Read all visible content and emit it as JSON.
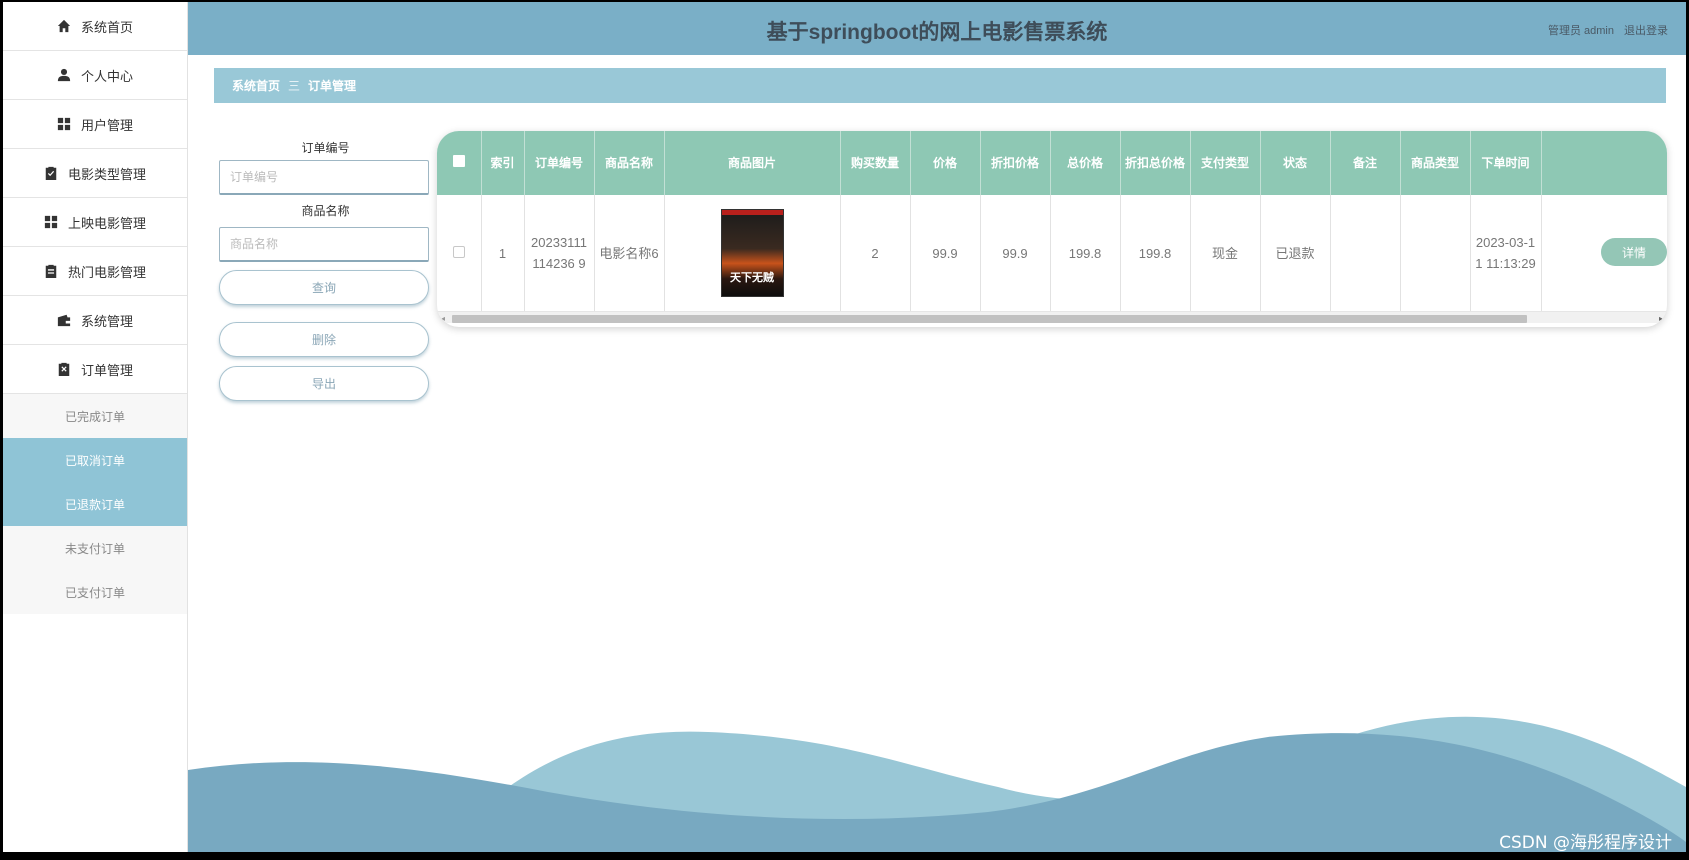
{
  "header": {
    "title": "基于springboot的网上电影售票系统",
    "user_label": "管理员 admin",
    "logout_label": "退出登录"
  },
  "sidebar": {
    "items": [
      {
        "label": "系统首页",
        "icon": "home-icon"
      },
      {
        "label": "个人中心",
        "icon": "user-icon"
      },
      {
        "label": "用户管理",
        "icon": "grid-icon"
      },
      {
        "label": "电影类型管理",
        "icon": "clipboard-check-icon"
      },
      {
        "label": "上映电影管理",
        "icon": "grid-icon"
      },
      {
        "label": "热门电影管理",
        "icon": "clipboard-icon"
      },
      {
        "label": "系统管理",
        "icon": "wallet-icon"
      },
      {
        "label": "订单管理",
        "icon": "clipboard-x-icon"
      }
    ],
    "sub_items": [
      {
        "label": "已完成订单",
        "active": false
      },
      {
        "label": "已取消订单",
        "active": true
      },
      {
        "label": "已退款订单",
        "active": true
      },
      {
        "label": "未支付订单",
        "active": false
      },
      {
        "label": "已支付订单",
        "active": false
      }
    ]
  },
  "breadcrumb": {
    "home": "系统首页",
    "separator": "三",
    "current": "订单管理"
  },
  "search": {
    "order_no_label": "订单编号",
    "order_no_placeholder": "订单编号",
    "product_name_label": "商品名称",
    "product_name_placeholder": "商品名称",
    "query_button": "查询",
    "delete_button": "删除",
    "export_button": "导出"
  },
  "table": {
    "headers": [
      "索引",
      "订单编号",
      "商品名称",
      "商品图片",
      "购买数量",
      "价格",
      "折扣价格",
      "总价格",
      "折扣总价格",
      "支付类型",
      "状态",
      "备注",
      "商品类型",
      "下单时间"
    ],
    "rows": [
      {
        "index": "1",
        "order_no": "20233111114236 9",
        "product_name": "电影名称6",
        "poster_caption": "天下无贼",
        "quantity": "2",
        "price": "99.9",
        "discount_price": "99.9",
        "total_price": "199.8",
        "discount_total": "199.8",
        "pay_type": "现金",
        "status": "已退款",
        "remark": "",
        "product_type": "",
        "order_time": "2023-03-11 11:13:29",
        "detail_button": "详情"
      }
    ]
  },
  "watermark": "CSDN @海彤程序设计",
  "colors": {
    "header_bg": "#7aafc7",
    "breadcrumb_bg": "#99c8d7",
    "table_header_bg": "#8ec8b4",
    "active_menu_bg": "#8fc4d6",
    "wave_dark": "#78a9c1",
    "wave_light": "#99c7d6"
  }
}
